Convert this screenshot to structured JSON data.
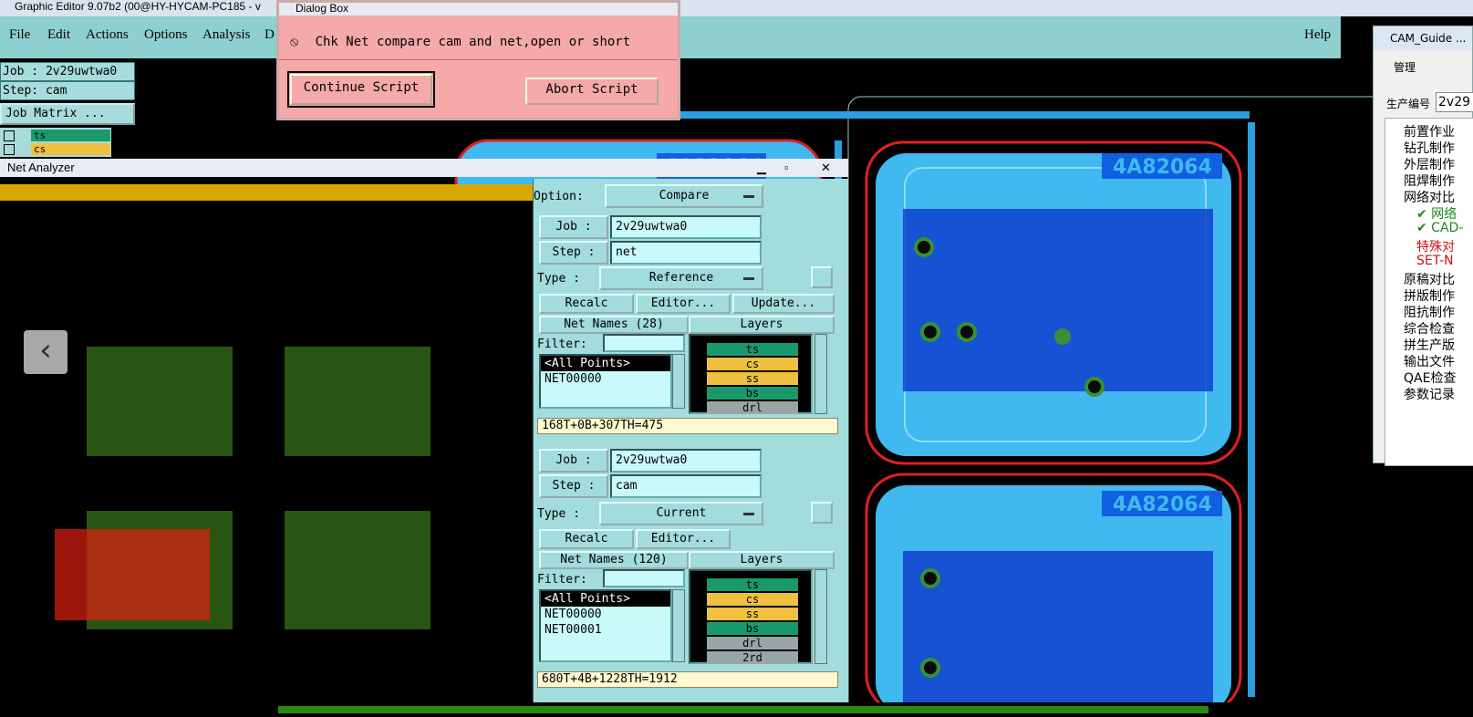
{
  "window_title": "Graphic Editor 9.07b2 (00@HY-HYCAM-PC185 - v",
  "menu": {
    "file": "File",
    "edit": "Edit",
    "actions": "Actions",
    "options": "Options",
    "analysis": "Analysis",
    "d": "D",
    "help": "Help"
  },
  "job_info": {
    "job": "Job : 2v29uwtwa0",
    "step": "Step: cam",
    "job_matrix": "Job Matrix ..."
  },
  "left_layers": [
    "ts",
    "cs"
  ],
  "dialog": {
    "title": "Dialog Box",
    "message": "Chk Net compare cam and net,open or short",
    "continue": "Continue Script",
    "abort": "Abort Script"
  },
  "analyzer": {
    "title": "Net Analyzer",
    "option_label": "Option:",
    "option_value": "Compare",
    "top": {
      "job_label": "Job :",
      "job": "2v29uwtwa0",
      "step_label": "Step :",
      "step": "net",
      "type_label": "Type :",
      "type": "Reference",
      "recalc": "Recalc",
      "editor": "Editor...",
      "update": "Update...",
      "net_names": "Net Names (28)",
      "layers_hdr": "Layers",
      "filter": "Filter:",
      "list": [
        "<All Points>",
        "NET00000"
      ],
      "layers": [
        "ts",
        "cs",
        "ss",
        "bs",
        "drl"
      ],
      "stat": "168T+0B+307TH=475"
    },
    "bottom": {
      "job_label": "Job :",
      "job": "2v29uwtwa0",
      "step_label": "Step :",
      "step": "cam",
      "type_label": "Type :",
      "type": "Current",
      "recalc": "Recalc",
      "editor": "Editor...",
      "net_names": "Net Names (120)",
      "layers_hdr": "Layers",
      "filter": "Filter:",
      "list": [
        "<All Points>",
        "NET00000",
        "NET00001"
      ],
      "layers": [
        "ts",
        "cs",
        "ss",
        "bs",
        "drl",
        "2rd"
      ],
      "stat": "680T+4B+1228TH=1912"
    }
  },
  "colors": {
    "ts": "#1a9a6a",
    "cs": "#f0c040",
    "ss": "#f0c040",
    "bs": "#1a9a6a",
    "drl": "#9aa6a6",
    "2rd": "#9aa6a6"
  },
  "guide": {
    "title": "CAM_Guide ...",
    "menu": "管理",
    "prod_label": "生产编号",
    "prod_value": "2v29",
    "items": [
      "前置作业",
      "钻孔制作",
      "外层制作",
      "阻焊制作",
      "网络对比",
      "✔ 网络",
      "✔ CAD-",
      "特殊对",
      "SET-N",
      "原稿对比",
      "拼版制作",
      "阻抗制作",
      "综合检查",
      "拼生产版",
      "输出文件",
      "QAE检查",
      "参数记录"
    ]
  },
  "board_label": "4A82064"
}
